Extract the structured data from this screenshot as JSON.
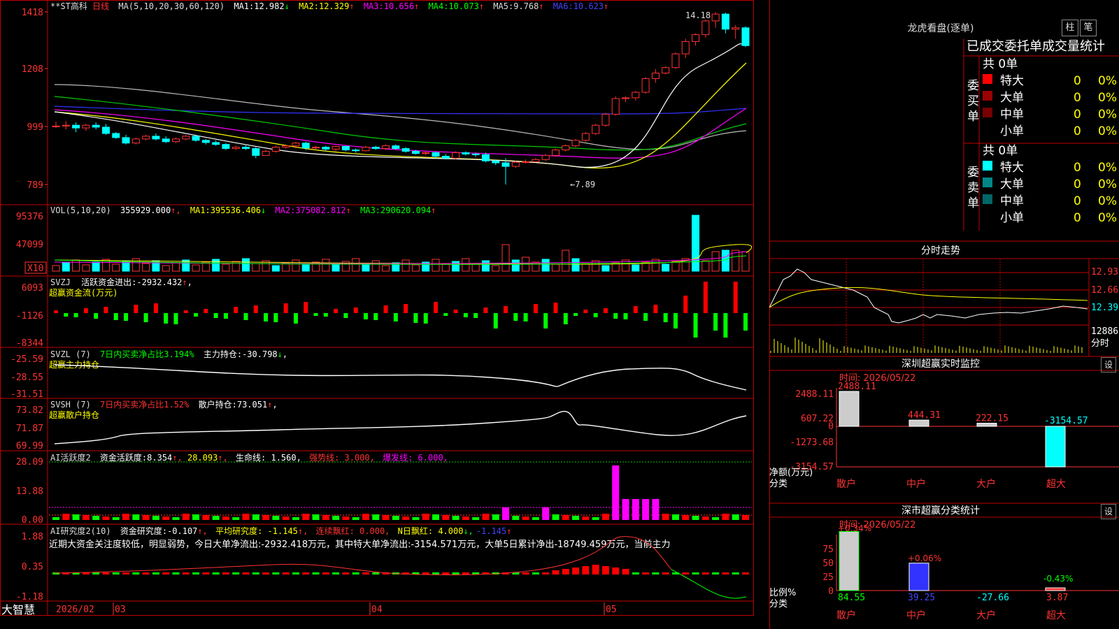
{
  "app": {
    "brand": "大智慧",
    "period_label": "日线",
    "stock_name": "**ST高科"
  },
  "main": {
    "ma_header": "MA(5,10,20,30,60,120)",
    "ma_items": [
      {
        "label": "MA1:",
        "value": "12.982",
        "arrow": "↓",
        "color": "#ffffff"
      },
      {
        "label": "MA2:",
        "value": "12.329",
        "arrow": "↑",
        "color": "#ffff00"
      },
      {
        "label": "MA3:",
        "value": "10.656",
        "arrow": "↑",
        "color": "#ff00ff"
      },
      {
        "label": "MA4:",
        "value": "10.073",
        "arrow": "↑",
        "color": "#00ff00"
      },
      {
        "label": "MA5:",
        "value": "9.768",
        "arrow": "↑",
        "color": "#dddddd"
      },
      {
        "label": "MA6:",
        "value": "10.623",
        "arrow": "↑",
        "color": "#4444ff"
      }
    ],
    "y_labels": [
      "1418",
      "1208",
      "999",
      "789"
    ],
    "high_label": "14.18",
    "low_label": "←7.89"
  },
  "vol": {
    "header": "VOL(5,10,20)",
    "value": "355929.000",
    "items": [
      {
        "label": "MA1:",
        "value": "395536.406",
        "arrow": "↓",
        "color": "#ffff00"
      },
      {
        "label": "MA2:",
        "value": "375082.812",
        "arrow": "↑",
        "color": "#ff00ff"
      },
      {
        "label": "MA3:",
        "value": "290620.094",
        "arrow": "↑",
        "color": "#00ff00"
      }
    ],
    "y_labels": [
      "95376",
      "47099"
    ],
    "unit": "X10"
  },
  "svzj": {
    "header": "SVZJ",
    "label": "活跃资金进出:",
    "value": "-2932.432",
    "sub": "超赢资金流(万元)",
    "y_labels": [
      "6093",
      "-1126",
      "-8344"
    ]
  },
  "svzl": {
    "header": "SVZL (7)",
    "ratio": "7日内买卖净占比3.194%",
    "label": "主力持仓:",
    "value": "-30.798",
    "sub": "超赢主力持仓",
    "y_labels": [
      "-25.59",
      "-28.55",
      "-31.51"
    ]
  },
  "svsh": {
    "header": "SVSH (7)",
    "ratio": "7日内买卖净占比1.52%",
    "label": "散户持仓:",
    "value": "73.051",
    "sub": "超赢散户持仓",
    "y_labels": [
      "73.82",
      "71.87",
      "69.99"
    ]
  },
  "ai2": {
    "header": "AI活跃度2",
    "label": "资金活跃度:",
    "value": "8.354",
    "v2": "28.093",
    "life": "生命线: 1.560,",
    "strong": "强势线: 3.000,",
    "burst": "爆发线: 6.000,",
    "y_labels": [
      "28.09",
      "13.88",
      "0.00"
    ]
  },
  "air": {
    "header": "AI研究度2(10)",
    "label": "资金研究度:",
    "value": "-0.107",
    "avg": "平均研究度: -1.145",
    "streak": "连续飘红: 0.000,",
    "nday": "N日飘红: 4.000",
    "neg": "-1.145",
    "text": "近期大资金关注度较低，明显弱势，今日大单净流出:-2932.418万元，其中特大单净流出:-3154.571万元，大单5日累计净出-18749.459万元，当前主力",
    "y_labels": [
      "1.88",
      "0.35",
      "-1.18"
    ]
  },
  "x_labels": [
    "2026/02",
    "03",
    "04",
    "05"
  ],
  "right": {
    "title": "龙虎看盘(逐单)",
    "btn1": "柱",
    "btn2": "笔",
    "stat_header": "已成交委托单成交量统计",
    "buy_side": "委买单",
    "sell_side": "委卖单",
    "buy_total": "共 0单",
    "sell_total": "共 0单",
    "buy_rows": [
      {
        "label": "特大",
        "count": "0",
        "pct": "0%",
        "color": "#ff0000"
      },
      {
        "label": "大单",
        "count": "0",
        "pct": "0%",
        "color": "#990000"
      },
      {
        "label": "中单",
        "count": "0",
        "pct": "0%",
        "color": "#770000"
      },
      {
        "label": "小单",
        "count": "0",
        "pct": "0%",
        "color": ""
      }
    ],
    "sell_rows": [
      {
        "label": "特大",
        "count": "0",
        "pct": "0%",
        "color": "#00ffff"
      },
      {
        "label": "大单",
        "count": "0",
        "pct": "0%",
        "color": "#008888"
      },
      {
        "label": "中单",
        "count": "0",
        "pct": "0%",
        "color": "#006666"
      },
      {
        "label": "小单",
        "count": "0",
        "pct": "0%",
        "color": ""
      }
    ],
    "intraday_title": "分时走势",
    "intraday_prices": [
      "12.93",
      "12.66",
      "12.39"
    ],
    "intraday_vol": "12886",
    "intraday_unit": "分时",
    "monitor_title": "深圳超赢实时监控",
    "gear": "设",
    "date": "时间: 2026/05/22",
    "monitor_y": [
      "2488.11",
      "607.22",
      "0",
      "-1273.68",
      "-3154.57"
    ],
    "net_label": "净额(万元)",
    "cat_label": "分类",
    "categories": [
      "散户",
      "中户",
      "大户",
      "超大"
    ],
    "monitor_values": [
      "2488.11",
      "444.31",
      "222.15",
      "-3154.57"
    ],
    "class_title": "深市超赢分类统计",
    "class_y": [
      "75",
      "50",
      "25",
      "0"
    ],
    "class_pct": [
      "+0.34%",
      "+0.06%",
      "",
      "-0.43%"
    ],
    "ratio_label": "比例%",
    "class_values": [
      "84.55",
      "39.25",
      "-27.66",
      "3.87"
    ]
  },
  "chart_data": [
    {
      "type": "candlestick",
      "title": "**ST高科 日线",
      "ylim": [
        7.89,
        14.18
      ],
      "y_ticks": [
        14.18,
        12.08,
        9.99,
        7.89
      ],
      "x_labels": [
        "2026/02",
        "03",
        "04",
        "05"
      ],
      "ohlc": [
        [
          10.0,
          10.18,
          9.95,
          10.02
        ],
        [
          10.02,
          10.2,
          9.9,
          10.05
        ],
        [
          10.05,
          10.15,
          9.8,
          9.95
        ],
        [
          9.95,
          10.1,
          9.85,
          10.05
        ],
        [
          10.05,
          10.15,
          9.9,
          9.98
        ],
        [
          9.98,
          10.1,
          9.7,
          9.75
        ],
        [
          9.75,
          9.8,
          9.55,
          9.6
        ],
        [
          9.6,
          9.7,
          9.35,
          9.4
        ],
        [
          9.4,
          9.6,
          9.35,
          9.55
        ],
        [
          9.55,
          9.7,
          9.5,
          9.65
        ],
        [
          9.65,
          9.75,
          9.5,
          9.55
        ],
        [
          9.55,
          9.65,
          9.4,
          9.45
        ],
        [
          9.45,
          9.6,
          9.4,
          9.55
        ],
        [
          9.55,
          9.7,
          9.5,
          9.65
        ],
        [
          9.65,
          9.7,
          9.45,
          9.5
        ],
        [
          9.5,
          9.55,
          9.35,
          9.42
        ],
        [
          9.42,
          9.5,
          9.3,
          9.35
        ],
        [
          9.35,
          9.4,
          9.15,
          9.2
        ],
        [
          9.2,
          9.3,
          9.15,
          9.25
        ],
        [
          9.25,
          9.35,
          9.15,
          9.2
        ],
        [
          9.2,
          9.25,
          8.85,
          8.95
        ],
        [
          8.95,
          9.15,
          8.95,
          9.1
        ],
        [
          9.1,
          9.3,
          9.05,
          9.25
        ],
        [
          9.25,
          9.35,
          9.2,
          9.3
        ],
        [
          9.3,
          9.45,
          9.2,
          9.4
        ],
        [
          9.4,
          9.45,
          9.15,
          9.22
        ],
        [
          9.22,
          9.3,
          9.15,
          9.25
        ],
        [
          9.25,
          9.3,
          9.1,
          9.18
        ],
        [
          9.18,
          9.3,
          9.1,
          9.28
        ],
        [
          9.28,
          9.3,
          9.1,
          9.15
        ],
        [
          9.15,
          9.2,
          9.05,
          9.12
        ],
        [
          9.12,
          9.3,
          9.1,
          9.25
        ],
        [
          9.25,
          9.3,
          9.15,
          9.2
        ],
        [
          9.2,
          9.35,
          9.15,
          9.3
        ],
        [
          9.3,
          9.35,
          9.15,
          9.2
        ],
        [
          9.2,
          9.25,
          9.05,
          9.1
        ],
        [
          9.1,
          9.15,
          8.98,
          9.02
        ],
        [
          9.02,
          9.1,
          8.95,
          9.05
        ],
        [
          9.05,
          9.1,
          8.85,
          8.92
        ],
        [
          8.92,
          9.0,
          8.8,
          8.85
        ],
        [
          8.85,
          9.1,
          8.8,
          9.05
        ],
        [
          9.05,
          9.1,
          8.95,
          9.0
        ],
        [
          9.0,
          9.05,
          8.9,
          8.98
        ],
        [
          8.98,
          9.05,
          8.7,
          8.75
        ],
        [
          8.75,
          8.8,
          8.6,
          8.68
        ],
        [
          8.68,
          8.85,
          7.89,
          8.55
        ],
        [
          8.55,
          8.75,
          8.5,
          8.7
        ],
        [
          8.7,
          8.8,
          8.65,
          8.72
        ],
        [
          8.72,
          8.85,
          8.7,
          8.8
        ],
        [
          8.8,
          9.0,
          8.75,
          8.95
        ],
        [
          8.95,
          9.2,
          8.9,
          9.15
        ],
        [
          9.15,
          9.35,
          9.1,
          9.3
        ],
        [
          9.3,
          9.55,
          9.25,
          9.5
        ],
        [
          9.5,
          9.8,
          9.45,
          9.75
        ],
        [
          9.75,
          10.1,
          9.7,
          10.05
        ],
        [
          10.05,
          10.5,
          10.0,
          10.45
        ],
        [
          10.45,
          11.1,
          10.4,
          11.02
        ],
        [
          11.02,
          11.1,
          10.9,
          11.05
        ],
        [
          11.05,
          11.3,
          10.95,
          11.25
        ],
        [
          11.25,
          11.8,
          11.2,
          11.75
        ],
        [
          11.75,
          12.1,
          11.6,
          11.95
        ],
        [
          11.95,
          12.2,
          11.9,
          12.15
        ],
        [
          12.15,
          12.7,
          12.1,
          12.65
        ],
        [
          12.65,
          13.2,
          12.5,
          13.1
        ],
        [
          13.1,
          13.4,
          12.95,
          13.35
        ],
        [
          13.35,
          13.9,
          13.25,
          13.85
        ],
        [
          13.85,
          14.18,
          13.6,
          14.1
        ],
        [
          14.1,
          14.15,
          13.4,
          13.55
        ],
        [
          13.55,
          13.7,
          13.2,
          13.6
        ],
        [
          13.6,
          13.65,
          12.9,
          12.95
        ]
      ]
    },
    {
      "type": "bar",
      "title": "深圳超赢实时监控",
      "categories": [
        "散户",
        "中户",
        "大户",
        "超大"
      ],
      "values": [
        2488.11,
        444.31,
        222.15,
        -3154.57
      ],
      "ylabel": "净额(万元)",
      "ylim": [
        -3154.57,
        2488.11
      ]
    },
    {
      "type": "bar",
      "title": "深市超赢分类统计",
      "categories": [
        "散户",
        "中户",
        "大户",
        "超大"
      ],
      "values": [
        84.55,
        39.25,
        -27.66,
        3.87
      ],
      "ylabel": "比例%",
      "ylim": [
        0,
        80
      ]
    }
  ]
}
